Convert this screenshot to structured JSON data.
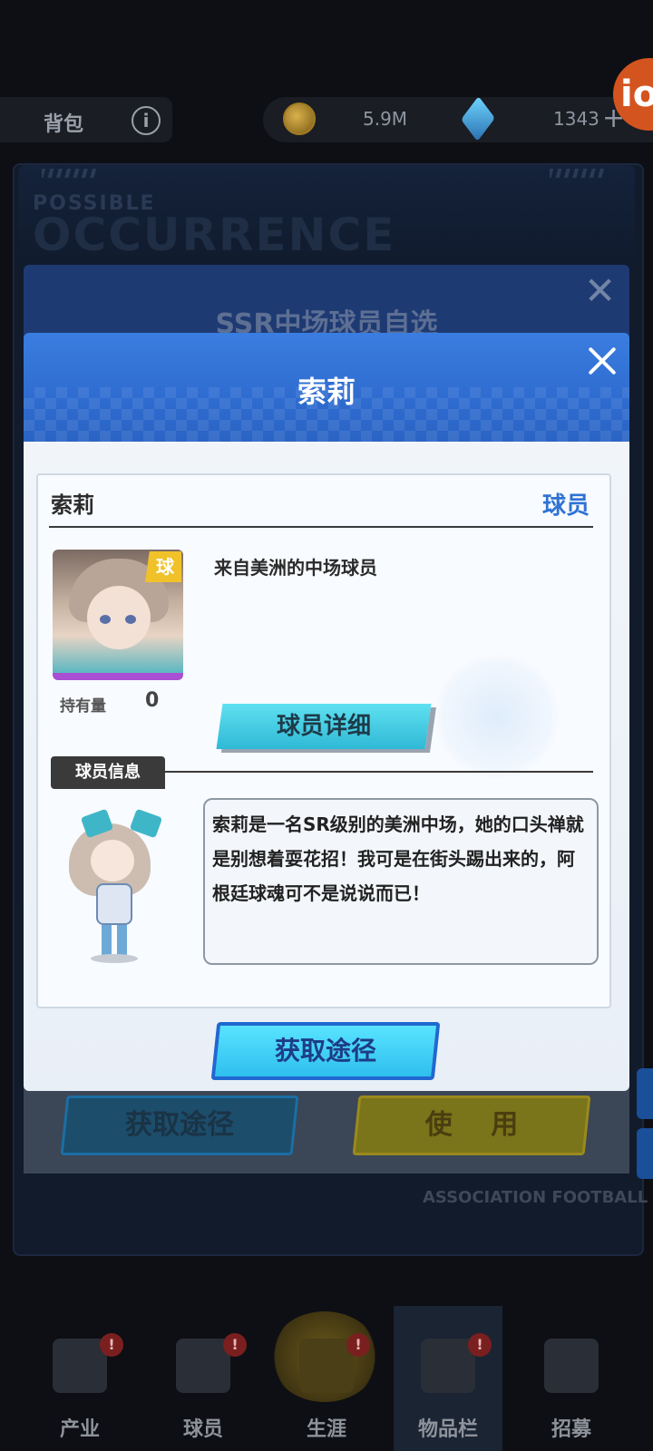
{
  "topbar": {
    "bag_label": "背包",
    "info_icon": "info-icon",
    "coins": "5.9M",
    "gems": "1343",
    "plus": "+",
    "corner_badge": "io"
  },
  "background_panel": {
    "ghost_small": "POSSIBLE",
    "ghost_big": "OCCURRENCE",
    "selector_title": "SSR中场球员自选",
    "get_route_label": "获取途径",
    "use_label": "使 用",
    "footer_text": "ASSOCIATION FOOTBALL"
  },
  "dialog": {
    "title": "索莉",
    "card": {
      "name": "索莉",
      "type": "球员",
      "badge": "球",
      "description": "来自美洲的中场球员",
      "owned_label": "持有量",
      "owned_count": "0",
      "detail_button": "球员详细",
      "info_tab": "球员信息",
      "story": "索莉是一名SR级别的美洲中场，她的口头禅就是别想着耍花招！我可是在街头踢出来的，阿根廷球魂可不是说说而已！"
    },
    "get_route_button": "获取途径"
  },
  "nav": {
    "items": [
      {
        "label": "产业",
        "icon": "building-icon",
        "alert": "!"
      },
      {
        "label": "球员",
        "icon": "players-icon",
        "alert": "!"
      },
      {
        "label": "生涯",
        "icon": "trophy-icon",
        "alert": "!"
      },
      {
        "label": "物品栏",
        "icon": "bag-icon",
        "alert": "!"
      },
      {
        "label": "招募",
        "icon": "stadium-icon",
        "alert": ""
      }
    ],
    "active": "物品栏"
  },
  "colors": {
    "dialog_header": "#3a7de0",
    "type_label": "#2f73d4",
    "detail_button": "#2fb9d6",
    "get_route_button": "#2fbfee",
    "use_button": "#7a741a"
  }
}
